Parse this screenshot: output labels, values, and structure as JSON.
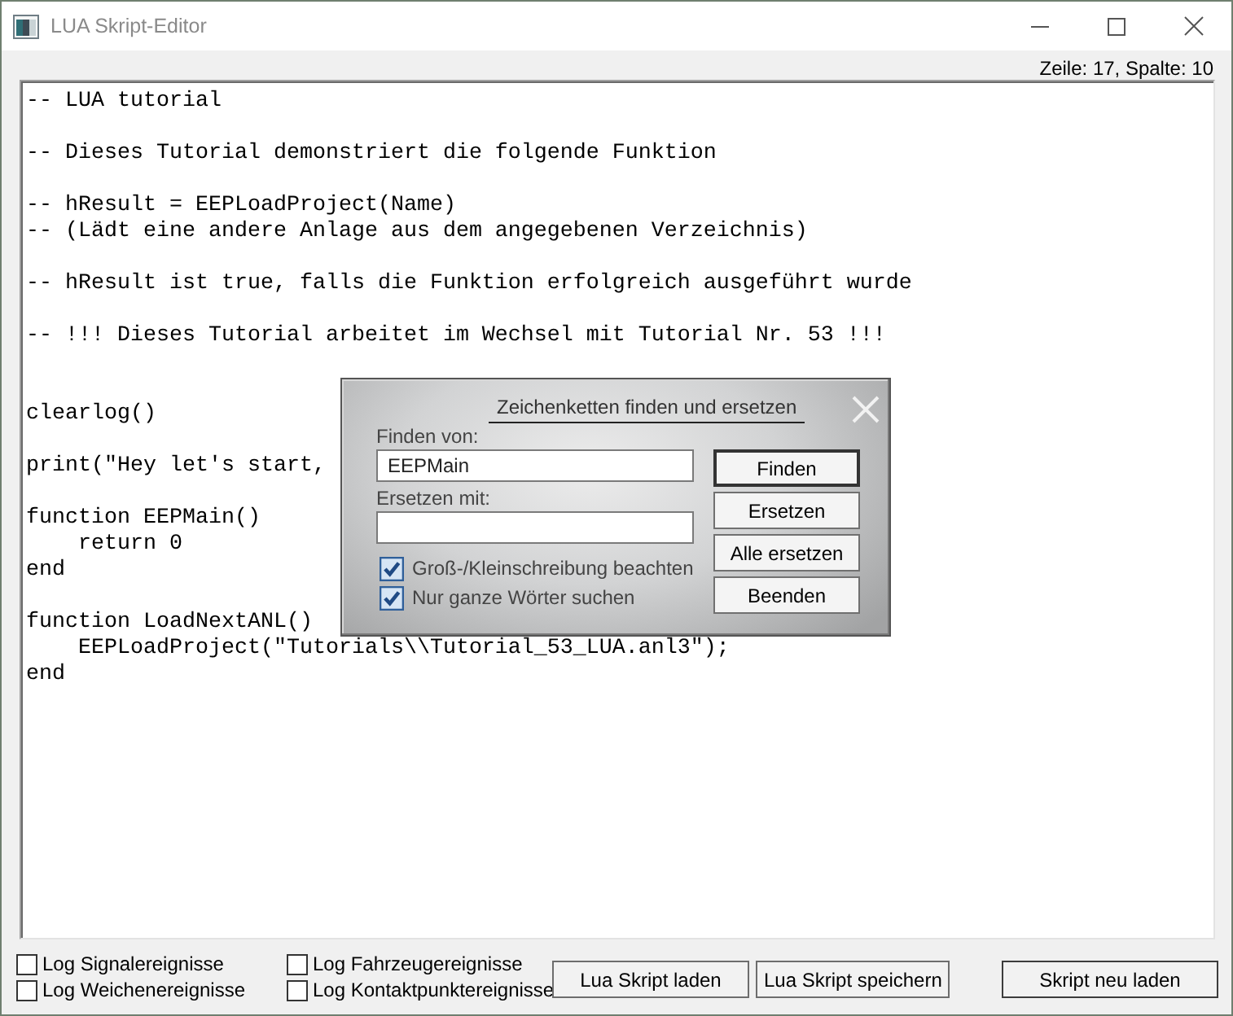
{
  "window": {
    "title": "LUA Skript-Editor"
  },
  "status": {
    "position": "Zeile: 17, Spalte: 10"
  },
  "editor": {
    "text": "-- LUA tutorial\n\n-- Dieses Tutorial demonstriert die folgende Funktion\n\n-- hResult = EEPLoadProject(Name)\n-- (Lädt eine andere Anlage aus dem angegebenen Verzeichnis)\n\n-- hResult ist true, falls die Funktion erfolgreich ausgeführt wurde\n\n-- !!! Dieses Tutorial arbeitet im Wechsel mit Tutorial Nr. 53 !!!\n\n\nclearlog()\n\nprint(\"Hey let's start,\n\nfunction EEPMain()\n    return 0\nend\n\nfunction LoadNextANL()\n    EEPLoadProject(\"Tutorials\\\\Tutorial_53_LUA.anl3\");\nend"
  },
  "find_dialog": {
    "title": "Zeichenketten finden und ersetzen",
    "find_label": "Finden von:",
    "find_value": "EEPMain",
    "replace_label": "Ersetzen mit:",
    "options": [
      {
        "label": "Groß-/Kleinschreibung beachten",
        "checked": true
      },
      {
        "label": "Nur ganze Wörter suchen",
        "checked": true
      }
    ],
    "buttons": [
      {
        "label": "Finden",
        "default": true
      },
      {
        "label": "Ersetzen",
        "default": false
      },
      {
        "label": "Alle ersetzen",
        "default": false
      },
      {
        "label": "Beenden",
        "default": false
      }
    ]
  },
  "log_options": [
    {
      "label": "Log Signalereignisse",
      "checked": false
    },
    {
      "label": "Log Weichenereignisse",
      "checked": false
    },
    {
      "label": "Log Fahrzeugereignisse",
      "checked": false
    },
    {
      "label": "Log Kontaktpunktereignisse",
      "checked": false
    }
  ],
  "buttons": [
    "Lua Skript laden",
    "Lua Skript speichern",
    "Skript neu laden"
  ]
}
